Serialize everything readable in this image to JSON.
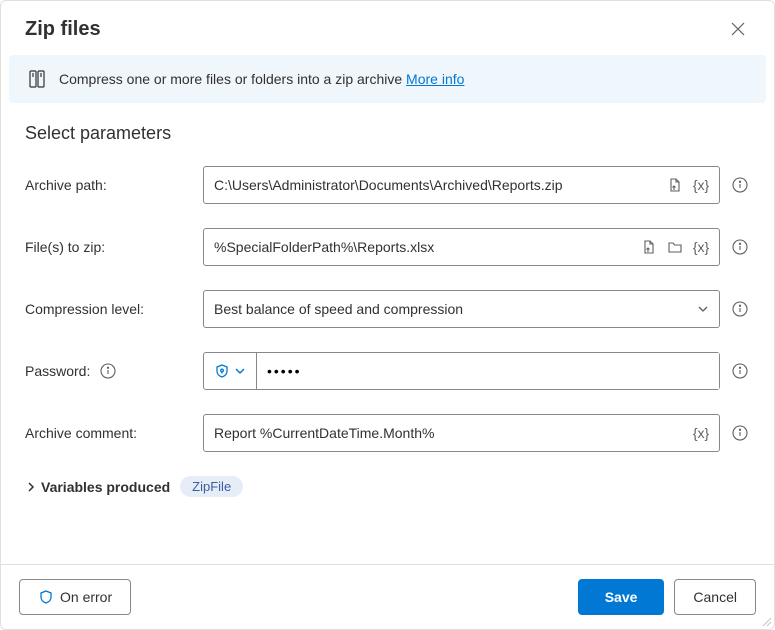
{
  "dialog": {
    "title": "Zip files"
  },
  "banner": {
    "text": "Compress one or more files or folders into a zip archive",
    "link": "More info"
  },
  "section": {
    "title": "Select parameters"
  },
  "labels": {
    "archivePath": "Archive path:",
    "filesToZip": "File(s) to zip:",
    "compressionLevel": "Compression level:",
    "password": "Password:",
    "archiveComment": "Archive comment:",
    "variablesProduced": "Variables produced"
  },
  "values": {
    "archivePath": "C:\\Users\\Administrator\\Documents\\Archived\\Reports.zip",
    "filesToZip": "%SpecialFolderPath%\\Reports.xlsx",
    "compressionLevel": "Best balance of speed and compression",
    "password": "•••••",
    "archiveComment": "Report %CurrentDateTime.Month%"
  },
  "variables": {
    "chip": "ZipFile"
  },
  "footer": {
    "onError": "On error",
    "save": "Save",
    "cancel": "Cancel"
  }
}
